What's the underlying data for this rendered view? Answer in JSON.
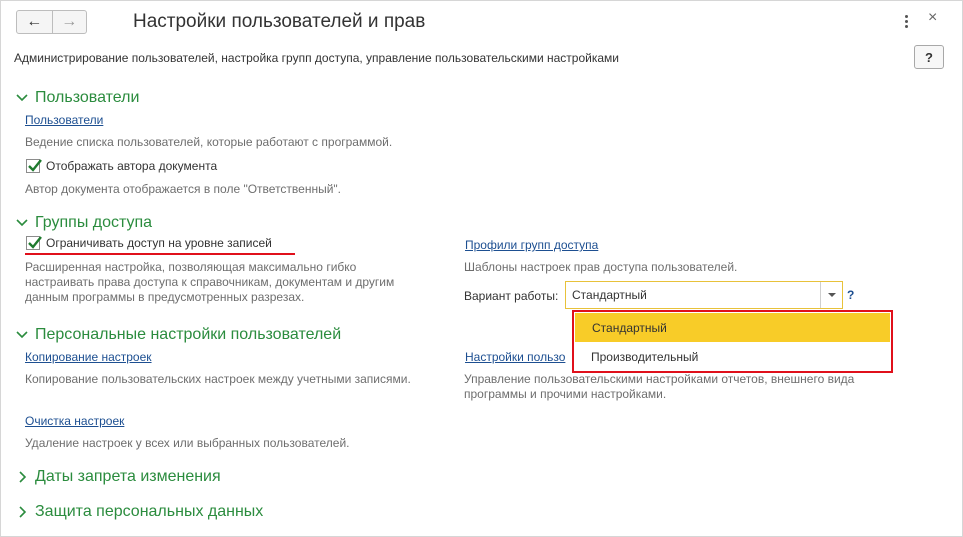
{
  "header": {
    "title": "Настройки пользователей и прав",
    "nav_back": "←",
    "nav_forward": "→",
    "more": "⋮",
    "close": "×",
    "help": "?"
  },
  "description": "Администрирование пользователей, настройка групп доступа, управление пользовательскими настройками",
  "users": {
    "title": "Пользователи",
    "link": "Пользователи",
    "link_desc": "Ведение списка пользователей, которые работают с программой.",
    "check_label": "Отображать автора документа",
    "check_checked": true,
    "check_desc": "Автор документа отображается в поле \"Ответственный\"."
  },
  "access": {
    "title": "Группы доступа",
    "check_label": "Ограничивать доступ на уровне записей",
    "check_checked": true,
    "check_desc": "Расширенная настройка, позволяющая максимально гибко настраивать права доступа к справочникам, документам и другим данным программы в предусмотренных разрезах.",
    "profiles_link": "Профили групп доступа",
    "profiles_desc": "Шаблоны настроек прав доступа пользователей.",
    "variant_label": "Вариант работы:",
    "variant_value": "Стандартный",
    "variant_help": "?",
    "options": [
      "Стандартный",
      "Производительный"
    ],
    "highlight_color": "#e0101b",
    "selected_color": "#f8cc28"
  },
  "personal": {
    "title": "Персональные настройки пользователей",
    "copy_link": "Копирование настроек",
    "copy_desc": "Копирование пользовательских настроек между учетными записями.",
    "user_settings_link": "Настройки пользо",
    "user_settings_desc": "Управление пользовательскими настройками отчетов, внешнего вида программы и прочими настройками.",
    "clear_link": "Очистка настроек",
    "clear_desc": "Удаление настроек у всех или выбранных пользователей."
  },
  "collapsed": {
    "dates": "Даты запрета изменения",
    "personal_data": "Защита персональных данных"
  },
  "colors": {
    "section": "#2b8c3e",
    "link": "#1d4f91"
  }
}
